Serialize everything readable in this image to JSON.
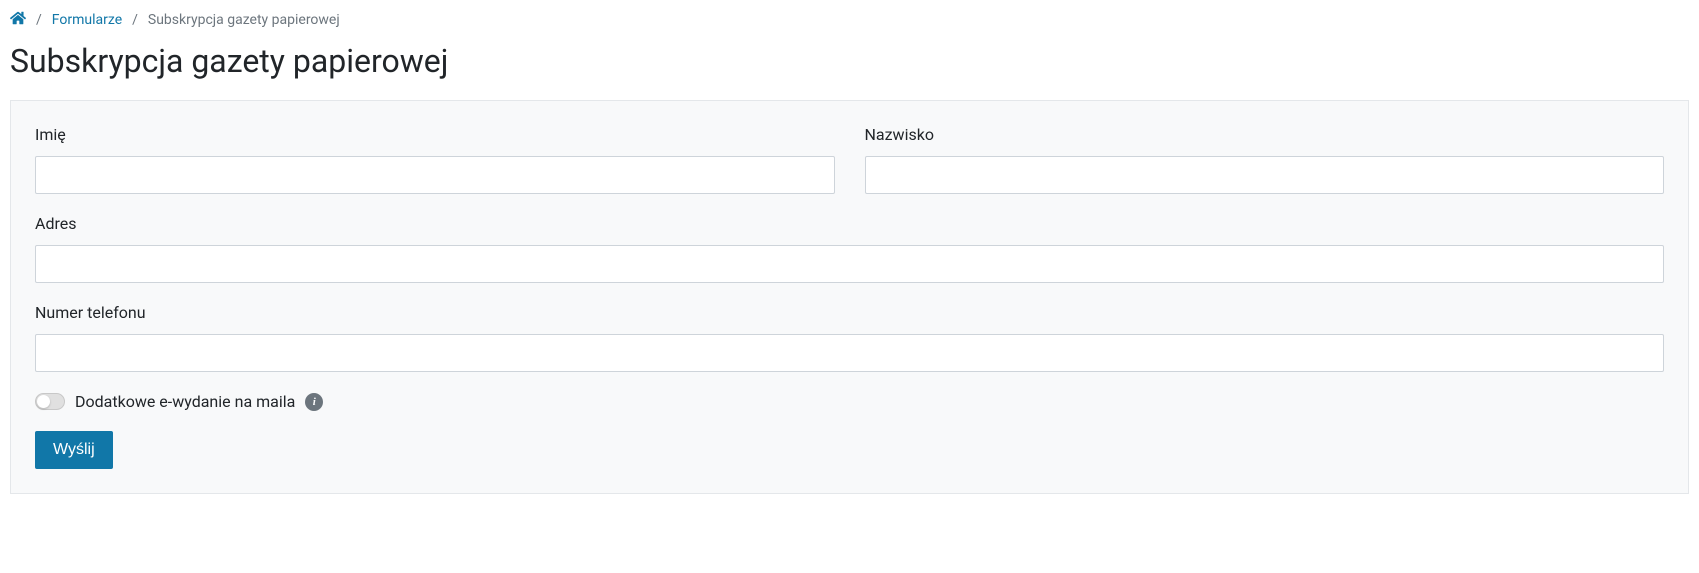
{
  "breadcrumb": {
    "forms_link": "Formularze",
    "current": "Subskrypcja gazety papierowej"
  },
  "page": {
    "title": "Subskrypcja gazety papierowej"
  },
  "form": {
    "firstname_label": "Imię",
    "firstname_value": "",
    "lastname_label": "Nazwisko",
    "lastname_value": "",
    "address_label": "Adres",
    "address_value": "",
    "phone_label": "Numer telefonu",
    "phone_value": "",
    "eedition_label": "Dodatkowe e-wydanie na maila",
    "eedition_checked": false,
    "submit_label": "Wyślij"
  }
}
